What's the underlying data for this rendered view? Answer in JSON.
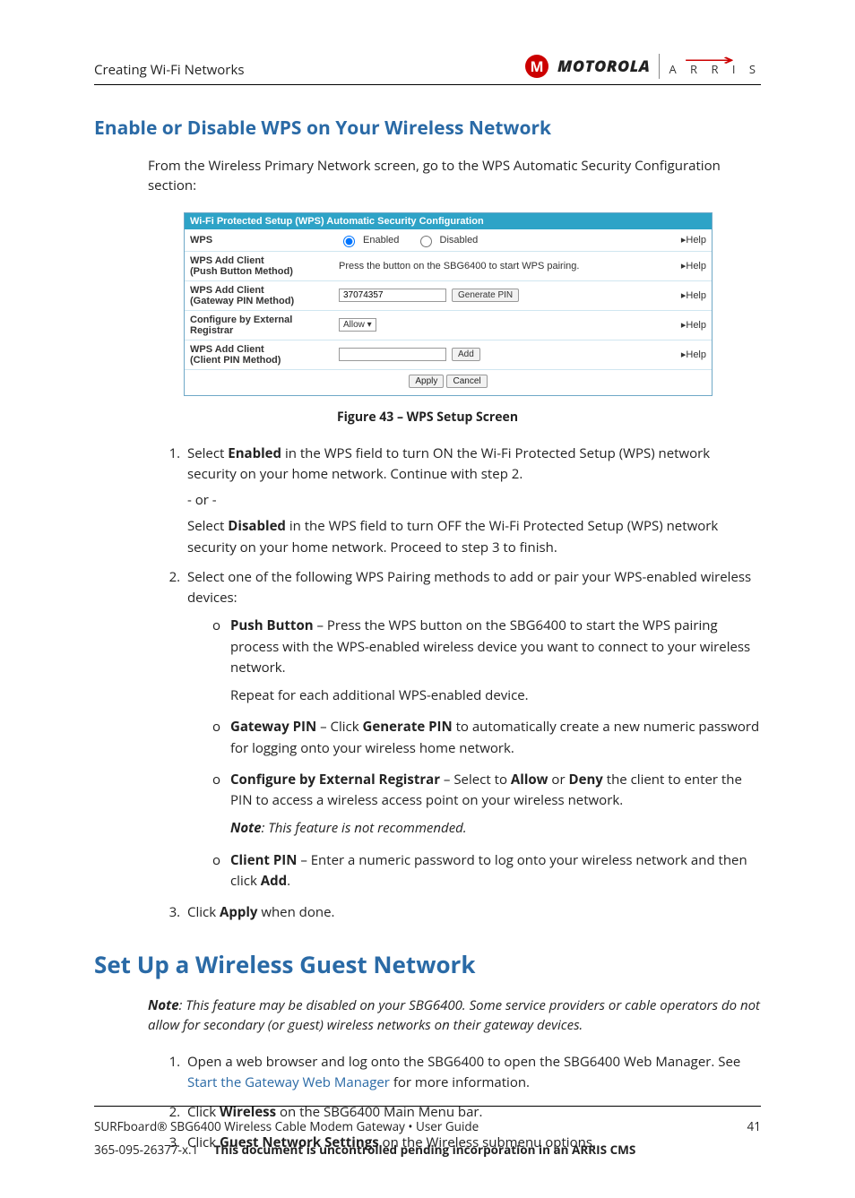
{
  "header": {
    "section": "Creating Wi-Fi Networks",
    "brand1": "MOTOROLA",
    "brand2": "A R R I S"
  },
  "h2": "Enable or Disable WPS on Your Wireless Network",
  "intro1": "From the Wireless Primary Network screen, go to the WPS Automatic Security Configuration section:",
  "figure": {
    "title": "Wi-Fi Protected Setup (WPS) Automatic Security Configuration",
    "rows": {
      "wps_label": "WPS",
      "enabled": "Enabled",
      "disabled": "Disabled",
      "push_label1": "WPS Add Client",
      "push_label2": "(Push Button Method)",
      "push_text": "Press the button on the SBG6400 to start WPS pairing.",
      "gw_label1": "WPS Add Client",
      "gw_label2": "(Gateway PIN Method)",
      "pin_value": "37074357",
      "gen_pin": "Generate PIN",
      "ext_label": "Configure by External Registrar",
      "allow": "Allow ▾",
      "cli_label1": "WPS Add Client",
      "cli_label2": "(Client PIN Method)",
      "add": "Add",
      "apply": "Apply",
      "cancel": "Cancel",
      "help": "Help"
    },
    "caption": "Figure 43 – WPS Setup Screen"
  },
  "steps1": {
    "s1a": "Select ",
    "s1b": "Enabled",
    "s1c": " in the WPS field to turn ON the Wi-Fi Protected Setup (WPS) network security on your home network. Continue with step 2.",
    "or": "- or -",
    "s1d": "Select ",
    "s1e": "Disabled",
    "s1f": " in the WPS field to turn OFF the Wi-Fi Protected Setup (WPS) network security on your home network. Proceed to step 3 to finish.",
    "s2": "Select one of the following WPS Pairing methods to add or pair your WPS-enabled wireless devices:",
    "pb_b": "Push Button",
    "pb_t": " – Press the WPS button on the SBG6400 to start the WPS pairing process with the WPS-enabled wireless device you want to connect to your wireless network.",
    "pb_r": "Repeat for each additional WPS-enabled device.",
    "gw_b": "Gateway PIN",
    "gw_t1": " – Click ",
    "gw_b2": "Generate PIN",
    "gw_t2": " to automatically create a new numeric password for logging onto your wireless home network.",
    "er_b": "Configure by External Registrar",
    "er_t1": " – Select to ",
    "er_b2": "Allow",
    "er_t2": " or ",
    "er_b3": "Deny",
    "er_t3": " the client to enter the PIN to access a wireless access point on your wireless network.",
    "er_note": "Note",
    "er_note_t": ": This feature is not recommended.",
    "cp_b": "Client PIN",
    "cp_t1": " – Enter a numeric password to log onto your wireless network and then click ",
    "cp_b2": "Add",
    "cp_t2": ".",
    "s3a": "Click ",
    "s3b": "Apply",
    "s3c": " when done."
  },
  "h1": "Set Up a Wireless Guest Network",
  "note2_b": "Note",
  "note2_t": ": This feature may be disabled on your SBG6400. Some service providers or cable operators do not allow for secondary (or guest) wireless networks on their gateway devices.",
  "steps2": {
    "s1a": "Open a web browser and log onto the SBG6400 to open the SBG6400 Web Manager. See ",
    "s1link": "Start the Gateway Web Manager",
    "s1b": " for more information.",
    "s2a": "Click ",
    "s2b": "Wireless",
    "s2c": " on the SBG6400 Main Menu bar.",
    "s3a": "Click ",
    "s3b": "Guest Network Settings",
    "s3c": " on the Wireless submenu options."
  },
  "footer": {
    "line1": "SURFboard® SBG6400 Wireless Cable Modem Gateway • User Guide",
    "page": "41",
    "docnum": "365-095-26377-x.1",
    "disclaimer": "This document is uncontrolled pending incorporation in an ARRIS CMS"
  }
}
